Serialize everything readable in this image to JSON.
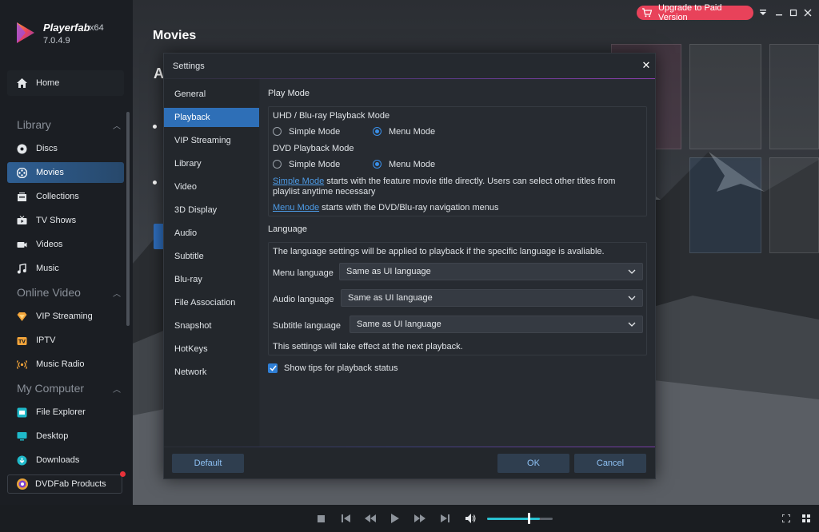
{
  "app": {
    "name": "Playerfab",
    "arch": "x64",
    "version": "7.0.4.9"
  },
  "sidebar": {
    "home": "Home",
    "sections": {
      "library": "Library",
      "online_video": "Online Video",
      "my_computer": "My Computer"
    },
    "library_items": [
      {
        "label": "Discs",
        "icon": "disc-icon"
      },
      {
        "label": "Movies",
        "icon": "movie-icon",
        "active": true
      },
      {
        "label": "Collections",
        "icon": "collections-icon"
      },
      {
        "label": "TV Shows",
        "icon": "tv-shows-icon"
      },
      {
        "label": "Videos",
        "icon": "video-icon"
      },
      {
        "label": "Music",
        "icon": "music-icon"
      }
    ],
    "online_items": [
      {
        "label": "VIP Streaming",
        "icon": "vip-icon"
      },
      {
        "label": "IPTV",
        "icon": "iptv-icon"
      },
      {
        "label": "Music Radio",
        "icon": "radio-icon"
      }
    ],
    "computer_items": [
      {
        "label": "File Explorer",
        "icon": "file-explorer-icon"
      },
      {
        "label": "Desktop",
        "icon": "desktop-icon"
      },
      {
        "label": "Downloads",
        "icon": "downloads-icon"
      }
    ],
    "products": "DVDFab Products"
  },
  "main": {
    "title": "Movies",
    "fragment": "A"
  },
  "topbar": {
    "upgrade": "Upgrade to Paid Version"
  },
  "player": {
    "volume_level": 0.8
  },
  "settings": {
    "title": "Settings",
    "menu": [
      "General",
      "Playback",
      "VIP Streaming",
      "Library",
      "Video",
      "3D Display",
      "Audio",
      "Subtitle",
      "Blu-ray",
      "File Association",
      "Snapshot",
      "HotKeys",
      "Network"
    ],
    "active_menu": "Playback",
    "play_mode": {
      "title": "Play Mode",
      "uhd_label": "UHD / Blu-ray Playback Mode",
      "dvd_label": "DVD Playback Mode",
      "simple": "Simple Mode",
      "menu": "Menu Mode",
      "uhd_selected": "Menu Mode",
      "dvd_selected": "Menu Mode",
      "simple_link": "Simple Mode",
      "simple_desc_1": " starts with the feature movie title directly. Users can select other titles from",
      "simple_desc_2": "playlist anytime necessary",
      "menu_link": "Menu Mode",
      "menu_desc": " starts with the DVD/Blu-ray navigation menus"
    },
    "language": {
      "title": "Language",
      "note": "The language settings will be applied to playback if the specific language is avaliable.",
      "menu_label": "Menu language",
      "menu_value": "Same as UI language",
      "audio_label": "Audio language",
      "audio_value": "Same as UI language",
      "subtitle_label": "Subtitle language",
      "subtitle_value": "Same as UI language",
      "footnote": "This settings will take effect at the next playback."
    },
    "tips": {
      "label": "Show tips for playback status",
      "checked": true
    },
    "buttons": {
      "default": "Default",
      "ok": "OK",
      "cancel": "Cancel"
    }
  },
  "colors": {
    "accent": "#2e6fb7",
    "upgrade": "#e8425a",
    "link": "#4d9be6",
    "volume": "#29c0d0"
  }
}
